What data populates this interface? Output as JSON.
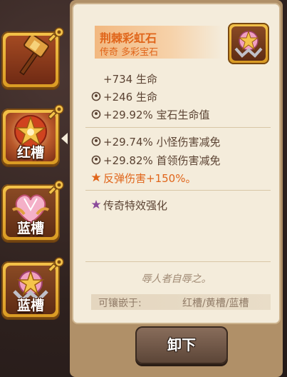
{
  "slots": [
    {
      "label": "",
      "icon": "hammer-weapon-icon"
    },
    {
      "label": "红槽",
      "icon": "red-gem-icon"
    },
    {
      "label": "蓝槽",
      "icon": "heart-gem-icon"
    },
    {
      "label": "蓝槽",
      "icon": "rainbow-gem-icon"
    }
  ],
  "item": {
    "name": "荆棘彩虹石",
    "subtitle": "传奇 多彩宝石",
    "icon": "rainbow-gem-icon"
  },
  "stats": {
    "base_life": "+734 生命",
    "life": "+246 生命",
    "gem_life": "+29.92% 宝石生命值",
    "minion_dr": "+29.74% 小怪伤害减免",
    "boss_dr": "+29.82% 首领伤害减免",
    "thorns": "反弹伤害+150%。",
    "legendary": "传奇特效强化"
  },
  "flavor": "辱人者自辱之。",
  "socket": {
    "label": "可镶嵌于:",
    "value": "红槽/黄槽/蓝槽"
  },
  "unequip_label": "卸下",
  "colors": {
    "accent": "#e0651a",
    "text": "#5b4333",
    "panel": "#f4ecdb"
  }
}
